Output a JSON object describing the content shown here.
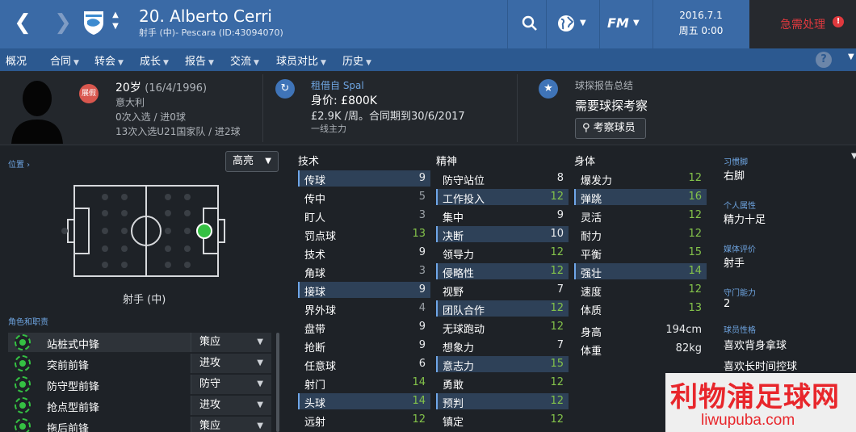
{
  "header": {
    "player_name": "20. Alberto Cerri",
    "player_sub": "射手 (中)- Pescara (ID:43094070)",
    "date": "2016.7.1",
    "day_time": "周五 0:00",
    "urgent_label": "急需处理",
    "urgent_badge": "!",
    "fm_label": "FM"
  },
  "menu": {
    "items": [
      "概况",
      "合同",
      "转会",
      "成长",
      "报告",
      "交流",
      "球员对比",
      "历史"
    ]
  },
  "profile": {
    "loan_tag": "展假",
    "age": "20岁",
    "dob": "(16/4/1996)",
    "nationality": "意大利",
    "caps": "0次入选 / 进0球",
    "u21_caps": "13次入选U21国家队 / 进2球"
  },
  "contract": {
    "loan_from": "租借自 Spal",
    "value": "身价: £800K",
    "wage": "£2.9K /周。合同期到30/6/2017",
    "status": "一线主力"
  },
  "scout": {
    "title": "球探报告总结",
    "status": "需要球探考察",
    "button": "考察球员"
  },
  "left_panel": {
    "position_link": "位置 ›",
    "highlight": "高亮",
    "position_label": "射手 (中)",
    "roles_title": "角色和职责",
    "roles": [
      {
        "name": "站桩式中锋",
        "duty": "策应"
      },
      {
        "name": "突前前锋",
        "duty": "进攻"
      },
      {
        "name": "防守型前锋",
        "duty": "防守"
      },
      {
        "name": "抢点型前锋",
        "duty": "进攻"
      },
      {
        "name": "拖后前锋",
        "duty": "策应"
      }
    ]
  },
  "attributes": {
    "technical_title": "技术",
    "mental_title": "精神",
    "physical_title": "身体",
    "technical": [
      {
        "label": "传球",
        "value": "9"
      },
      {
        "label": "传中",
        "value": "5"
      },
      {
        "label": "盯人",
        "value": "3"
      },
      {
        "label": "罚点球",
        "value": "13"
      },
      {
        "label": "技术",
        "value": "9"
      },
      {
        "label": "角球",
        "value": "3"
      },
      {
        "label": "接球",
        "value": "9"
      },
      {
        "label": "界外球",
        "value": "4"
      },
      {
        "label": "盘带",
        "value": "9"
      },
      {
        "label": "抢断",
        "value": "9"
      },
      {
        "label": "任意球",
        "value": "6"
      },
      {
        "label": "射门",
        "value": "14"
      },
      {
        "label": "头球",
        "value": "14"
      },
      {
        "label": "远射",
        "value": "12"
      }
    ],
    "mental": [
      {
        "label": "防守站位",
        "value": "8"
      },
      {
        "label": "工作投入",
        "value": "12"
      },
      {
        "label": "集中",
        "value": "9"
      },
      {
        "label": "决断",
        "value": "10"
      },
      {
        "label": "领导力",
        "value": "12"
      },
      {
        "label": "侵略性",
        "value": "12"
      },
      {
        "label": "视野",
        "value": "7"
      },
      {
        "label": "团队合作",
        "value": "12"
      },
      {
        "label": "无球跑动",
        "value": "12"
      },
      {
        "label": "想象力",
        "value": "7"
      },
      {
        "label": "意志力",
        "value": "15"
      },
      {
        "label": "勇敢",
        "value": "12"
      },
      {
        "label": "预判",
        "value": "12"
      },
      {
        "label": "镇定",
        "value": "12"
      }
    ],
    "physical": [
      {
        "label": "爆发力",
        "value": "12"
      },
      {
        "label": "弹跳",
        "value": "16"
      },
      {
        "label": "灵活",
        "value": "12"
      },
      {
        "label": "耐力",
        "value": "12"
      },
      {
        "label": "平衡",
        "value": "15"
      },
      {
        "label": "强壮",
        "value": "14"
      },
      {
        "label": "速度",
        "value": "12"
      },
      {
        "label": "体质",
        "value": "13"
      }
    ],
    "height_label": "身高",
    "height": "194cm",
    "weight_label": "体重",
    "weight": "82kg"
  },
  "sidebar": {
    "foot_label": "习惯脚",
    "foot": "右脚",
    "personality_label": "个人属性",
    "personality": "精力十足",
    "media_label": "媒体评价",
    "media": "射手",
    "defense_label": "守门能力",
    "defense": "2",
    "traits_label": "球员性格",
    "traits": [
      "喜欢背身拿球",
      "喜欢长时间控球"
    ]
  },
  "watermark": {
    "cn": "利物浦足球网",
    "en": "liwupuba.com"
  },
  "colors": {
    "topbar": "#3a6aa6",
    "menubar": "#2c5990",
    "urgent": "#e0393e",
    "green_value": "#83c24a",
    "highlight_row": "#2e4158"
  }
}
